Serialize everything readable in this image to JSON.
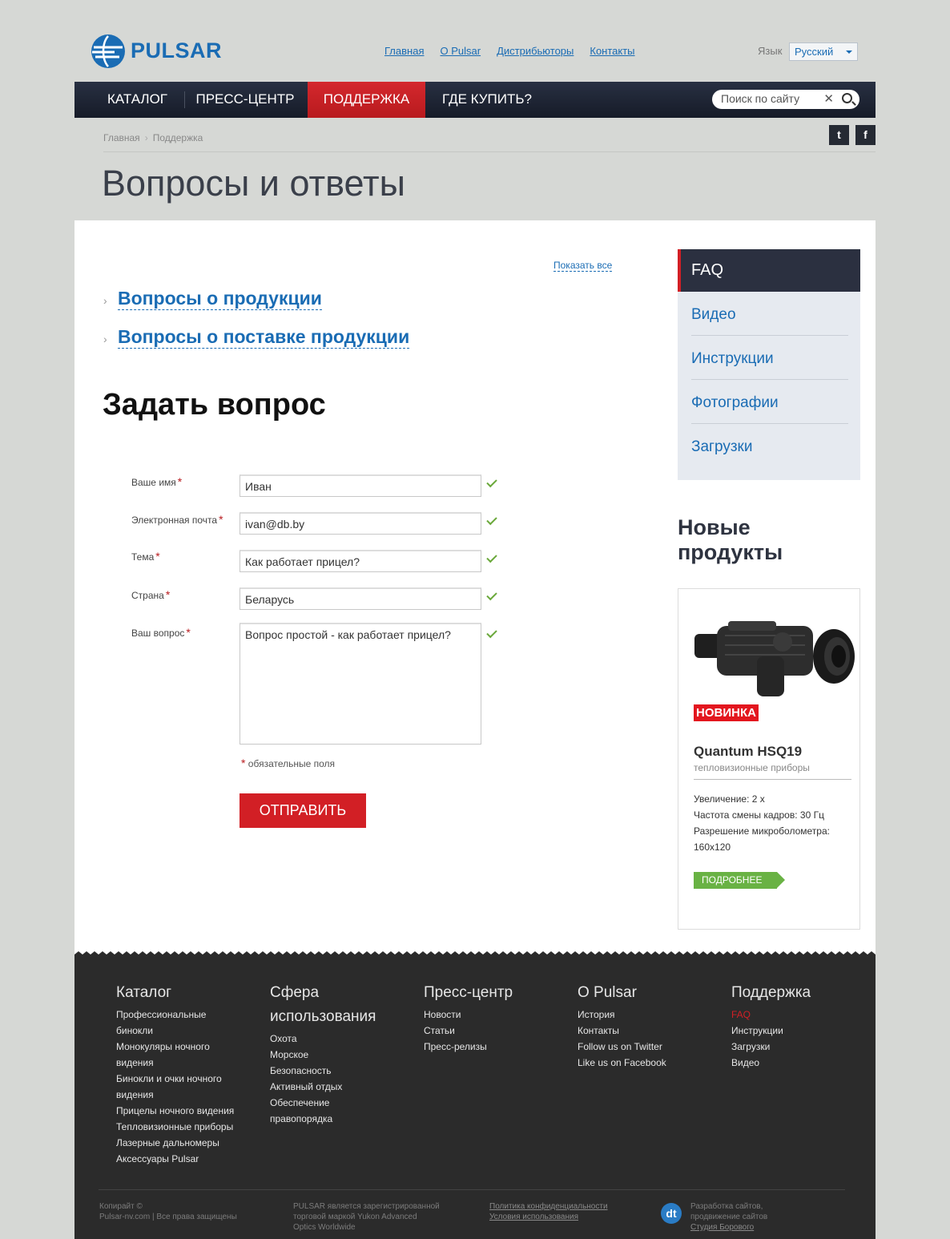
{
  "header": {
    "logo_text": "PULSAR",
    "top_links": [
      "Главная",
      "O Pulsar",
      "Дистрибьюторы",
      "Контакты"
    ],
    "lang_label": "Язык",
    "lang_value": "Русский",
    "nav": [
      "КАТАЛОГ",
      "ПРЕСС-ЦЕНТР",
      "ПОДДЕРЖКА",
      "ГДЕ КУПИТЬ?"
    ],
    "search_placeholder": "Поиск по сайту",
    "search_clear": "✕"
  },
  "breadcrumb": [
    "Главная",
    "Поддержка"
  ],
  "social": {
    "twitter": "t",
    "facebook": "f"
  },
  "page_title": "Вопросы и ответы",
  "faq": {
    "show_all": "Показать все",
    "groups": [
      "Вопросы о продукции",
      "Вопросы о поставке продукции"
    ]
  },
  "form": {
    "title": "Задать вопрос",
    "fields": [
      {
        "label": "Ваше имя",
        "value": "Иван"
      },
      {
        "label": "Электронная почта",
        "value": "ivan@db.by"
      },
      {
        "label": "Тема",
        "value": "Как работает прицел?"
      },
      {
        "label": "Страна",
        "value": "Беларусь"
      },
      {
        "label": "Ваш вопрос",
        "value": "Вопрос простой - как работает прицел?"
      }
    ],
    "required_mark": "*",
    "required_note": "обязательные поля",
    "submit": "ОТПРАВИТЬ"
  },
  "sidebar": {
    "active": "FAQ",
    "links": [
      "Видео",
      "Инструкции",
      "Фотографии",
      "Загрузки"
    ]
  },
  "new_products": {
    "title_line1": "Новые",
    "title_line2": "продукты",
    "badge": "НОВИНКА",
    "name": "Quantum HSQ19",
    "category": "тепловизионные приборы",
    "specs": [
      "Увеличение: 2 х",
      "Частота смены кадров: 30 Гц",
      "Разрешение микроболометра:",
      "160х120"
    ],
    "more": "ПОДРОБНЕЕ"
  },
  "footer": {
    "columns": [
      {
        "title": "Каталог",
        "items": [
          "Профессиональные",
          "бинокли",
          "Монокуляры ночного",
          "видения",
          "Бинокли и очки ночного",
          "видения",
          "Прицелы ночного видения",
          "Тепловизионные приборы",
          "Лазерные дальномеры",
          "Аксессуары Pulsar"
        ]
      },
      {
        "title": "Сфера",
        "title2": "использования",
        "items": [
          "Охота",
          "Морское",
          "Безопасность",
          "Активный отдых",
          "Обеспечение",
          "правопорядка"
        ]
      },
      {
        "title": "Пресс-центр",
        "items": [
          "Новости",
          "Статьи",
          "Пресс-релизы"
        ]
      },
      {
        "title": "O Pulsar",
        "items": [
          "История",
          "Контакты",
          "Follow us on Twitter",
          "Like us on Facebook"
        ]
      },
      {
        "title": "Поддержка",
        "items": [
          "FAQ",
          "Инструкции",
          "Загрузки",
          "Видео"
        ]
      }
    ],
    "copyright_1": "Копирайт ©",
    "copyright_2": "Pulsar-nv.com | Все права защищены",
    "trademark_1": "PULSAR является зарегистрированной",
    "trademark_2": "торговой маркой Yukon Advanced",
    "trademark_3": "Optics Worldwide",
    "policy": "Политика конфиденциальности",
    "terms": "Условия использования",
    "dev_1": "Разработка сайтов,",
    "dev_2": "продвижение сайтов",
    "dev_3": "Студия Борового",
    "dev_logo": "dt"
  },
  "colors": {
    "brand_blue": "#1a6cb4",
    "accent_red": "#d21f25",
    "nav_dark": "#1d2230",
    "green": "#69b244"
  }
}
